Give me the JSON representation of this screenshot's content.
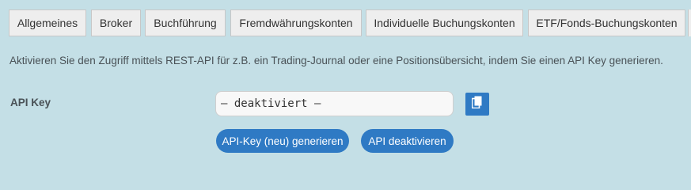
{
  "tabs": [
    {
      "label": "Allgemeines"
    },
    {
      "label": "Broker"
    },
    {
      "label": "Buchführung"
    },
    {
      "label": "Fremdwährungskonten"
    },
    {
      "label": "Individuelle Buchungskonten"
    },
    {
      "label": "ETF/Fonds-Buchungskonten"
    }
  ],
  "description": "Aktivieren Sie den Zugriff mittels REST-API für z.B. ein Trading-Journal oder eine Positionsübersicht, indem Sie einen API Key generieren.",
  "api_key": {
    "label": "API Key",
    "value": "– deaktiviert –"
  },
  "actions": {
    "generate": "API-Key (neu) generieren",
    "deactivate": "API deaktivieren"
  },
  "colors": {
    "background": "#c4dfe6",
    "accent": "#2f7ac4"
  },
  "icons": {
    "copy": "copy-icon"
  }
}
